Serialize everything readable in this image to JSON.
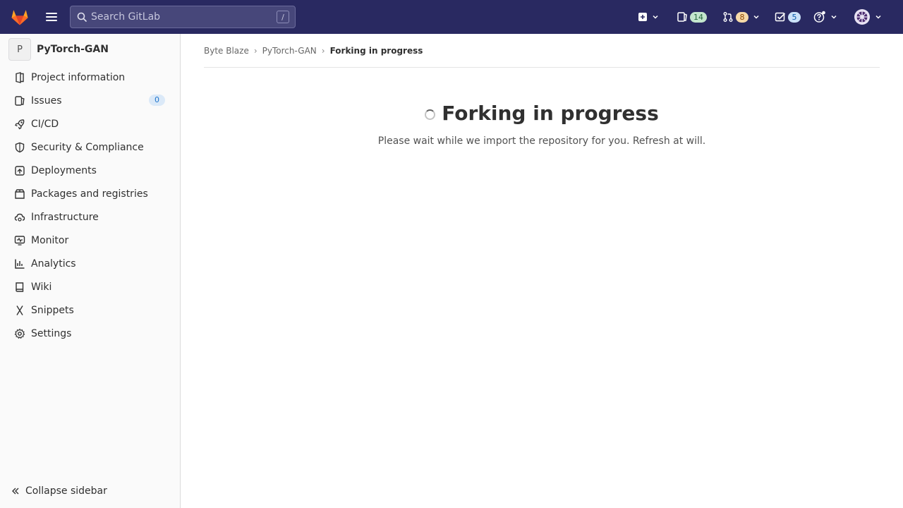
{
  "topbar": {
    "search_placeholder": "Search GitLab",
    "search_shortcut": "/",
    "issues_count": "14",
    "merge_requests_count": "8",
    "todos_count": "5"
  },
  "sidebar": {
    "project_initial": "P",
    "project_name": "PyTorch-GAN",
    "items": [
      {
        "label": "Project information",
        "icon": "project-icon"
      },
      {
        "label": "Issues",
        "icon": "issues-icon",
        "count": "0"
      },
      {
        "label": "CI/CD",
        "icon": "rocket-icon"
      },
      {
        "label": "Security & Compliance",
        "icon": "shield-icon"
      },
      {
        "label": "Deployments",
        "icon": "deployments-icon"
      },
      {
        "label": "Packages and registries",
        "icon": "package-icon"
      },
      {
        "label": "Infrastructure",
        "icon": "cloud-gear-icon"
      },
      {
        "label": "Monitor",
        "icon": "monitor-icon"
      },
      {
        "label": "Analytics",
        "icon": "chart-icon"
      },
      {
        "label": "Wiki",
        "icon": "book-icon"
      },
      {
        "label": "Snippets",
        "icon": "scissors-icon"
      },
      {
        "label": "Settings",
        "icon": "gear-icon"
      }
    ],
    "collapse_label": "Collapse sidebar"
  },
  "breadcrumbs": [
    "Byte Blaze",
    "PyTorch-GAN",
    "Forking in progress"
  ],
  "main": {
    "title": "Forking in progress",
    "message": "Please wait while we import the repository for you. Refresh at will."
  },
  "colors": {
    "navbar": "#292961",
    "sidebar_bg": "#fafafa"
  }
}
